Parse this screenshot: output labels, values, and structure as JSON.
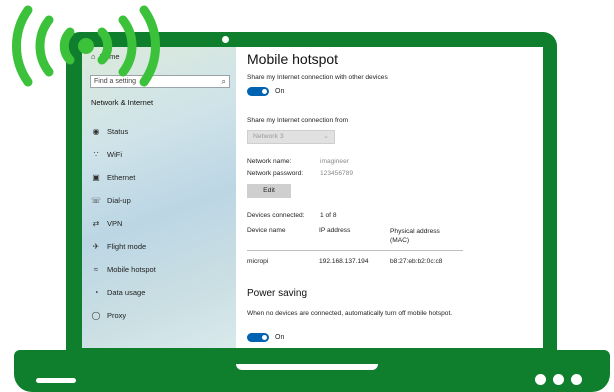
{
  "window": {
    "home_label": "Home",
    "search_placeholder": "Find a setting",
    "section_title": "Network & Internet"
  },
  "sidebar": {
    "items": [
      {
        "label": "Status",
        "icon": "status-icon"
      },
      {
        "label": "WiFi",
        "icon": "wifi-icon"
      },
      {
        "label": "Ethernet",
        "icon": "ethernet-icon"
      },
      {
        "label": "Dial-up",
        "icon": "dialup-icon"
      },
      {
        "label": "VPN",
        "icon": "vpn-icon"
      },
      {
        "label": "Flight mode",
        "icon": "flight-mode-icon"
      },
      {
        "label": "Mobile hotspot",
        "icon": "mobile-hotspot-icon"
      },
      {
        "label": "Data usage",
        "icon": "data-usage-icon"
      },
      {
        "label": "Proxy",
        "icon": "proxy-icon"
      }
    ]
  },
  "main": {
    "title": "Mobile hotspot",
    "share_label": "Share my Internet connection with other devices",
    "share_toggle": "On",
    "share_from_label": "Share my Internet connection from",
    "share_from_value": "Network 3",
    "network_name_label": "Network name:",
    "network_name_value": "imagineer",
    "network_password_label": "Network password:",
    "network_password_value": "123456789",
    "edit_button": "Edit",
    "devices_connected_label": "Devices connected:",
    "devices_connected_value": "1 of 8",
    "table": {
      "headers": [
        "Device name",
        "IP address",
        "Physical address (MAC)"
      ],
      "rows": [
        {
          "name": "micropi",
          "ip": "192.168.137.194",
          "mac": "b8:27:eb:b2:0c:c8"
        }
      ]
    },
    "power_saving_title": "Power saving",
    "power_saving_text": "When no devices are connected, automatically turn off mobile hotspot.",
    "power_saving_toggle": "On"
  },
  "colors": {
    "laptop": "#0f7f2d",
    "wifi_signal": "#3cc13b",
    "toggle_on": "#0063b1"
  }
}
